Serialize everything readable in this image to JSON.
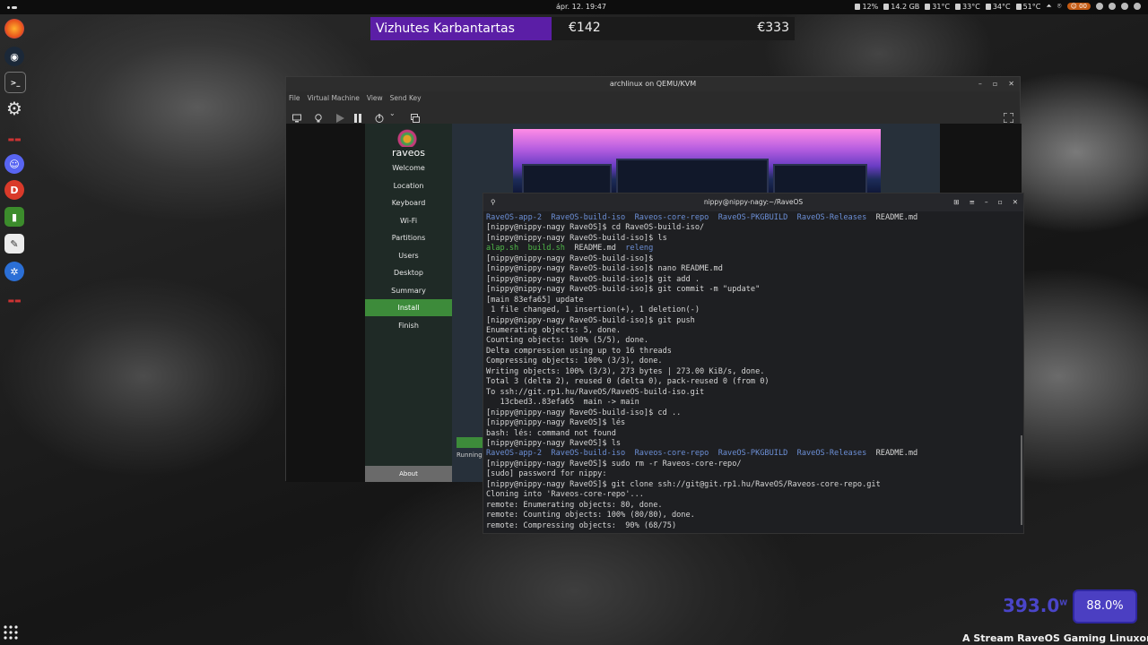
{
  "topbar": {
    "clock": "ápr. 12.  19:47",
    "stats": [
      "12%",
      "14.2 GB",
      "31°C",
      "33°C",
      "34°C",
      "51°C"
    ],
    "pill": "☺ 00"
  },
  "banner": {
    "name": "Vizhutes Karbantartas",
    "value1": "€142",
    "value2": "€333"
  },
  "qemu": {
    "title": "archlinux on QEMU/KVM",
    "menu": [
      "File",
      "Virtual Machine",
      "View",
      "Send Key"
    ],
    "installer": {
      "brand": "raveos",
      "steps": [
        "Welcome",
        "Location",
        "Keyboard",
        "Wi-Fi",
        "Partitions",
        "Users",
        "Desktop",
        "Summary",
        "Install",
        "Finish"
      ],
      "active_step": "Install",
      "about": "About",
      "running": "Running"
    }
  },
  "terminal": {
    "title": "nippy@nippy-nagy:~/RaveOS",
    "lines": [
      [
        [
          "RaveOS-app-2  RaveOS-build-iso  Raveos-core-repo  RaveOS-PKGBUILD  RaveOS-Releases",
          "blue"
        ],
        [
          "  README.md",
          ""
        ]
      ],
      [
        [
          "[nippy@nippy-nagy RaveOS]$ cd RaveOS-build-iso/",
          ""
        ]
      ],
      [
        [
          "[nippy@nippy-nagy RaveOS-build-iso]$ ls",
          ""
        ]
      ],
      [
        [
          "alap.sh  build.sh",
          "green"
        ],
        [
          "  README.md  ",
          ""
        ],
        [
          "releng",
          "blue"
        ]
      ],
      [
        [
          "[nippy@nippy-nagy RaveOS-build-iso]$",
          ""
        ]
      ],
      [
        [
          "[nippy@nippy-nagy RaveOS-build-iso]$ nano README.md",
          ""
        ]
      ],
      [
        [
          "[nippy@nippy-nagy RaveOS-build-iso]$ git add .",
          ""
        ]
      ],
      [
        [
          "[nippy@nippy-nagy RaveOS-build-iso]$ git commit -m \"update\"",
          ""
        ]
      ],
      [
        [
          "[main 83efa65] update",
          ""
        ]
      ],
      [
        [
          " 1 file changed, 1 insertion(+), 1 deletion(-)",
          ""
        ]
      ],
      [
        [
          "[nippy@nippy-nagy RaveOS-build-iso]$ git push",
          ""
        ]
      ],
      [
        [
          "Enumerating objects: 5, done.",
          ""
        ]
      ],
      [
        [
          "Counting objects: 100% (5/5), done.",
          ""
        ]
      ],
      [
        [
          "Delta compression using up to 16 threads",
          ""
        ]
      ],
      [
        [
          "Compressing objects: 100% (3/3), done.",
          ""
        ]
      ],
      [
        [
          "Writing objects: 100% (3/3), 273 bytes | 273.00 KiB/s, done.",
          ""
        ]
      ],
      [
        [
          "Total 3 (delta 2), reused 0 (delta 0), pack-reused 0 (from 0)",
          ""
        ]
      ],
      [
        [
          "To ssh://git.rp1.hu/RaveOS/RaveOS-build-iso.git",
          ""
        ]
      ],
      [
        [
          "   13cbed3..83efa65  main -> main",
          ""
        ]
      ],
      [
        [
          "[nippy@nippy-nagy RaveOS-build-iso]$ cd ..",
          ""
        ]
      ],
      [
        [
          "[nippy@nippy-nagy RaveOS]$ lés",
          ""
        ]
      ],
      [
        [
          "bash: lés: command not found",
          ""
        ]
      ],
      [
        [
          "[nippy@nippy-nagy RaveOS]$ ls",
          ""
        ]
      ],
      [
        [
          "RaveOS-app-2  RaveOS-build-iso  Raveos-core-repo  RaveOS-PKGBUILD  RaveOS-Releases",
          "blue"
        ],
        [
          "  README.md",
          ""
        ]
      ],
      [
        [
          "[nippy@nippy-nagy RaveOS]$ sudo rm -r Raveos-core-repo/",
          ""
        ]
      ],
      [
        [
          "[sudo] password for nippy:",
          ""
        ]
      ],
      [
        [
          "[nippy@nippy-nagy RaveOS]$ git clone ssh://git@git.rp1.hu/RaveOS/Raveos-core-repo.git",
          ""
        ]
      ],
      [
        [
          "Cloning into 'Raveos-core-repo'...",
          ""
        ]
      ],
      [
        [
          "remote: Enumerating objects: 80, done.",
          ""
        ]
      ],
      [
        [
          "remote: Counting objects: 100% (80/80), done.",
          ""
        ]
      ],
      [
        [
          "remote: Compressing objects:  90% (68/75)",
          ""
        ]
      ]
    ]
  },
  "overlay": {
    "power": "393.0",
    "power_unit": "W",
    "percent": "88.0%",
    "ticker": "A Stream RaveOS Gaming Linuxon fut"
  },
  "colors": {
    "accent_purple": "#5b1ea6",
    "install_green": "#3d8b3a",
    "terminal_dir_blue": "#6c8fd6",
    "terminal_exec_green": "#4fb848"
  }
}
